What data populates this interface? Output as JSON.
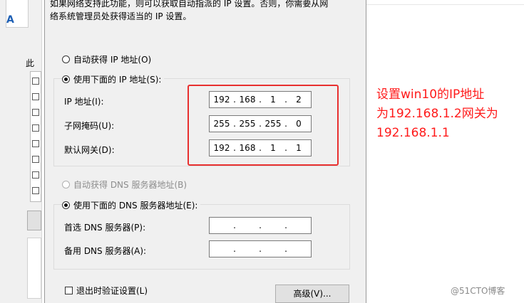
{
  "background_window": {
    "label_fragment": "此",
    "accent_letter": "A"
  },
  "dialog": {
    "description_line1": "如果网络支持此功能，则可以获取自动指派的 IP 设置。否则，你需要从网",
    "description_line2": "络系统管理员处获得适当的 IP 设置。",
    "ip_auto_label": "自动获得 IP 地址(O)",
    "ip_manual_label": "使用下面的 IP 地址(S):",
    "ip_address_label": "IP 地址(I):",
    "subnet_label": "子网掩码(U):",
    "gateway_label": "默认网关(D):",
    "ip_address": [
      "192",
      "168",
      "1",
      "2"
    ],
    "subnet_mask": [
      "255",
      "255",
      "255",
      "0"
    ],
    "gateway": [
      "192",
      "168",
      "1",
      "1"
    ],
    "dns_auto_label": "自动获得 DNS 服务器地址(B)",
    "dns_manual_label": "使用下面的 DNS 服务器地址(E):",
    "dns_preferred_label": "首选 DNS 服务器(P):",
    "dns_alternate_label": "备用 DNS 服务器(A):",
    "dns_preferred": [
      "",
      "",
      "",
      ""
    ],
    "dns_alternate": [
      "",
      "",
      "",
      ""
    ],
    "validate_label": "退出时验证设置(L)",
    "advanced_button": "高级(V)..."
  },
  "annotation": {
    "line1": "设置win10的IP地址",
    "line2": "为192.168.1.2网关为",
    "line3": "192.168.1.1"
  },
  "watermark": "@51CTO博客",
  "colors": {
    "annotation": "#ff1a1a",
    "highlight_border": "#e8302f",
    "dialog_background": "#f0f0f0"
  }
}
